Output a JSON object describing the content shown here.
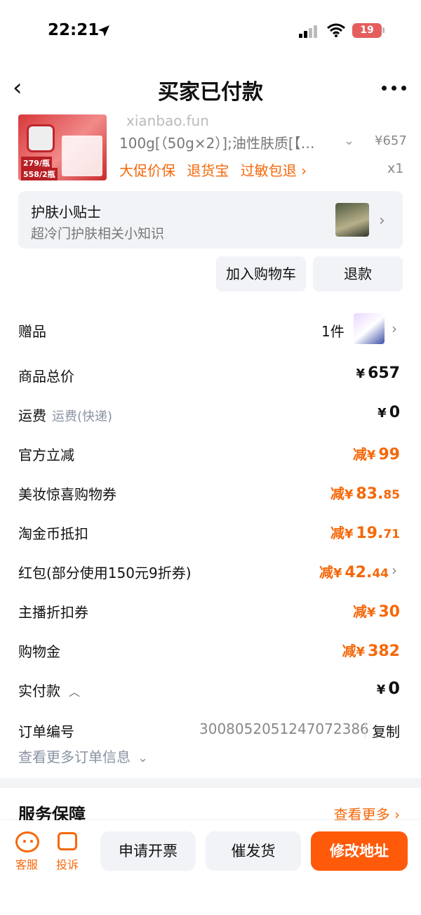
{
  "status_bar": {
    "time": "22:21",
    "battery": "19"
  },
  "nav": {
    "title": "买家已付款"
  },
  "product": {
    "image_labels": [
      "279/瓶",
      "558/2瓶"
    ],
    "watermark": "xianbao.fun",
    "sku": "100g[（50g×2）];油性肤质[【…",
    "price": "¥657",
    "quantity": "x1",
    "tags": [
      "大促价保",
      "退货宝",
      "过敏包退 ›"
    ]
  },
  "tip_card": {
    "title": "护肤小贴士",
    "subtitle": "超冷门护肤相关小知识"
  },
  "actions": {
    "add_to_cart": "加入购物车",
    "refund": "退款"
  },
  "rows": {
    "gift": {
      "label": "赠品",
      "count": "1件"
    },
    "total": {
      "label": "商品总价",
      "yen": "¥",
      "value": "657"
    },
    "shipping": {
      "label": "运费",
      "sub": "运费(快递)",
      "yen": "¥",
      "value": "0"
    },
    "official": {
      "label": "官方立减",
      "prefix": "减",
      "yen": "¥",
      "value": "99",
      "dec": ""
    },
    "beauty": {
      "label": "美妆惊喜购物券",
      "prefix": "减",
      "yen": "¥",
      "value": "83.",
      "dec": "85"
    },
    "taojin": {
      "label": "淘金币抵扣",
      "prefix": "减",
      "yen": "¥",
      "value": "19.",
      "dec": "71"
    },
    "redpack": {
      "label": "红包(部分使用150元9折券)",
      "prefix": "减",
      "yen": "¥",
      "value": "42.",
      "dec": "44"
    },
    "anchor": {
      "label": "主播折扣券",
      "prefix": "减",
      "yen": "¥",
      "value": "30",
      "dec": ""
    },
    "voucher": {
      "label": "购物金",
      "prefix": "减",
      "yen": "¥",
      "value": "382",
      "dec": ""
    },
    "paid": {
      "label": "实付款",
      "yen": "¥",
      "value": "0"
    }
  },
  "order": {
    "label": "订单编号",
    "number": "3008052051247072386",
    "copy": "复制",
    "more": "查看更多订单信息"
  },
  "service": {
    "title": "服务保障",
    "more": "查看更多 ›"
  },
  "bottom_bar": {
    "customer_service": "客服",
    "complaint": "投诉",
    "invoice": "申请开票",
    "urge": "催发货",
    "change_address": "修改地址"
  },
  "colors": {
    "accent": "#f5680a",
    "primary_button": "#ff5a0a",
    "card_bg": "#f1f3f7"
  }
}
